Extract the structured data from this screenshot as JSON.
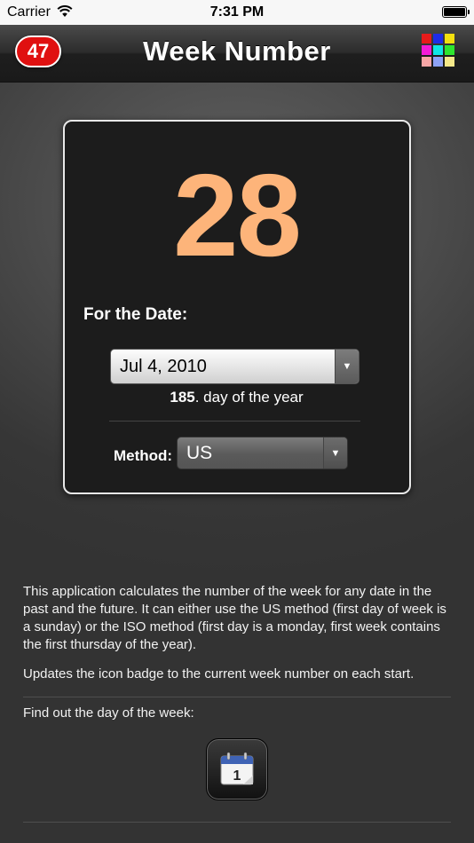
{
  "status_bar": {
    "carrier": "Carrier",
    "time": "7:31 PM"
  },
  "nav": {
    "badge": "47",
    "title": "Week Number",
    "grid_colors": [
      "#e61b1b",
      "#1f2ce8",
      "#f3e00e",
      "#f21bd8",
      "#0ee6e6",
      "#2ee62e",
      "#f7a6a6",
      "#8ea2f6",
      "#f4e889"
    ]
  },
  "card": {
    "week_number": "28",
    "for_date_label": "For the Date:",
    "date_value": "Jul 4, 2010",
    "day_of_year_num": "185",
    "day_of_year_suffix": ". day of the year",
    "method_label": "Method:",
    "method_value": "US"
  },
  "description": {
    "paragraph1": "This application calculates the number of the week for any date in the past and the future. It can either use the US method (first day of week is a sunday) or the ISO method (first day is a monday, first week contains the first thursday of the year).",
    "paragraph2": "Updates the icon badge to the current week number on each start.",
    "find_out": "Find out the day of the week:",
    "calendar_day": "1"
  },
  "colors": {
    "accent_number": "#fdb47a",
    "badge_red": "#e01010"
  }
}
